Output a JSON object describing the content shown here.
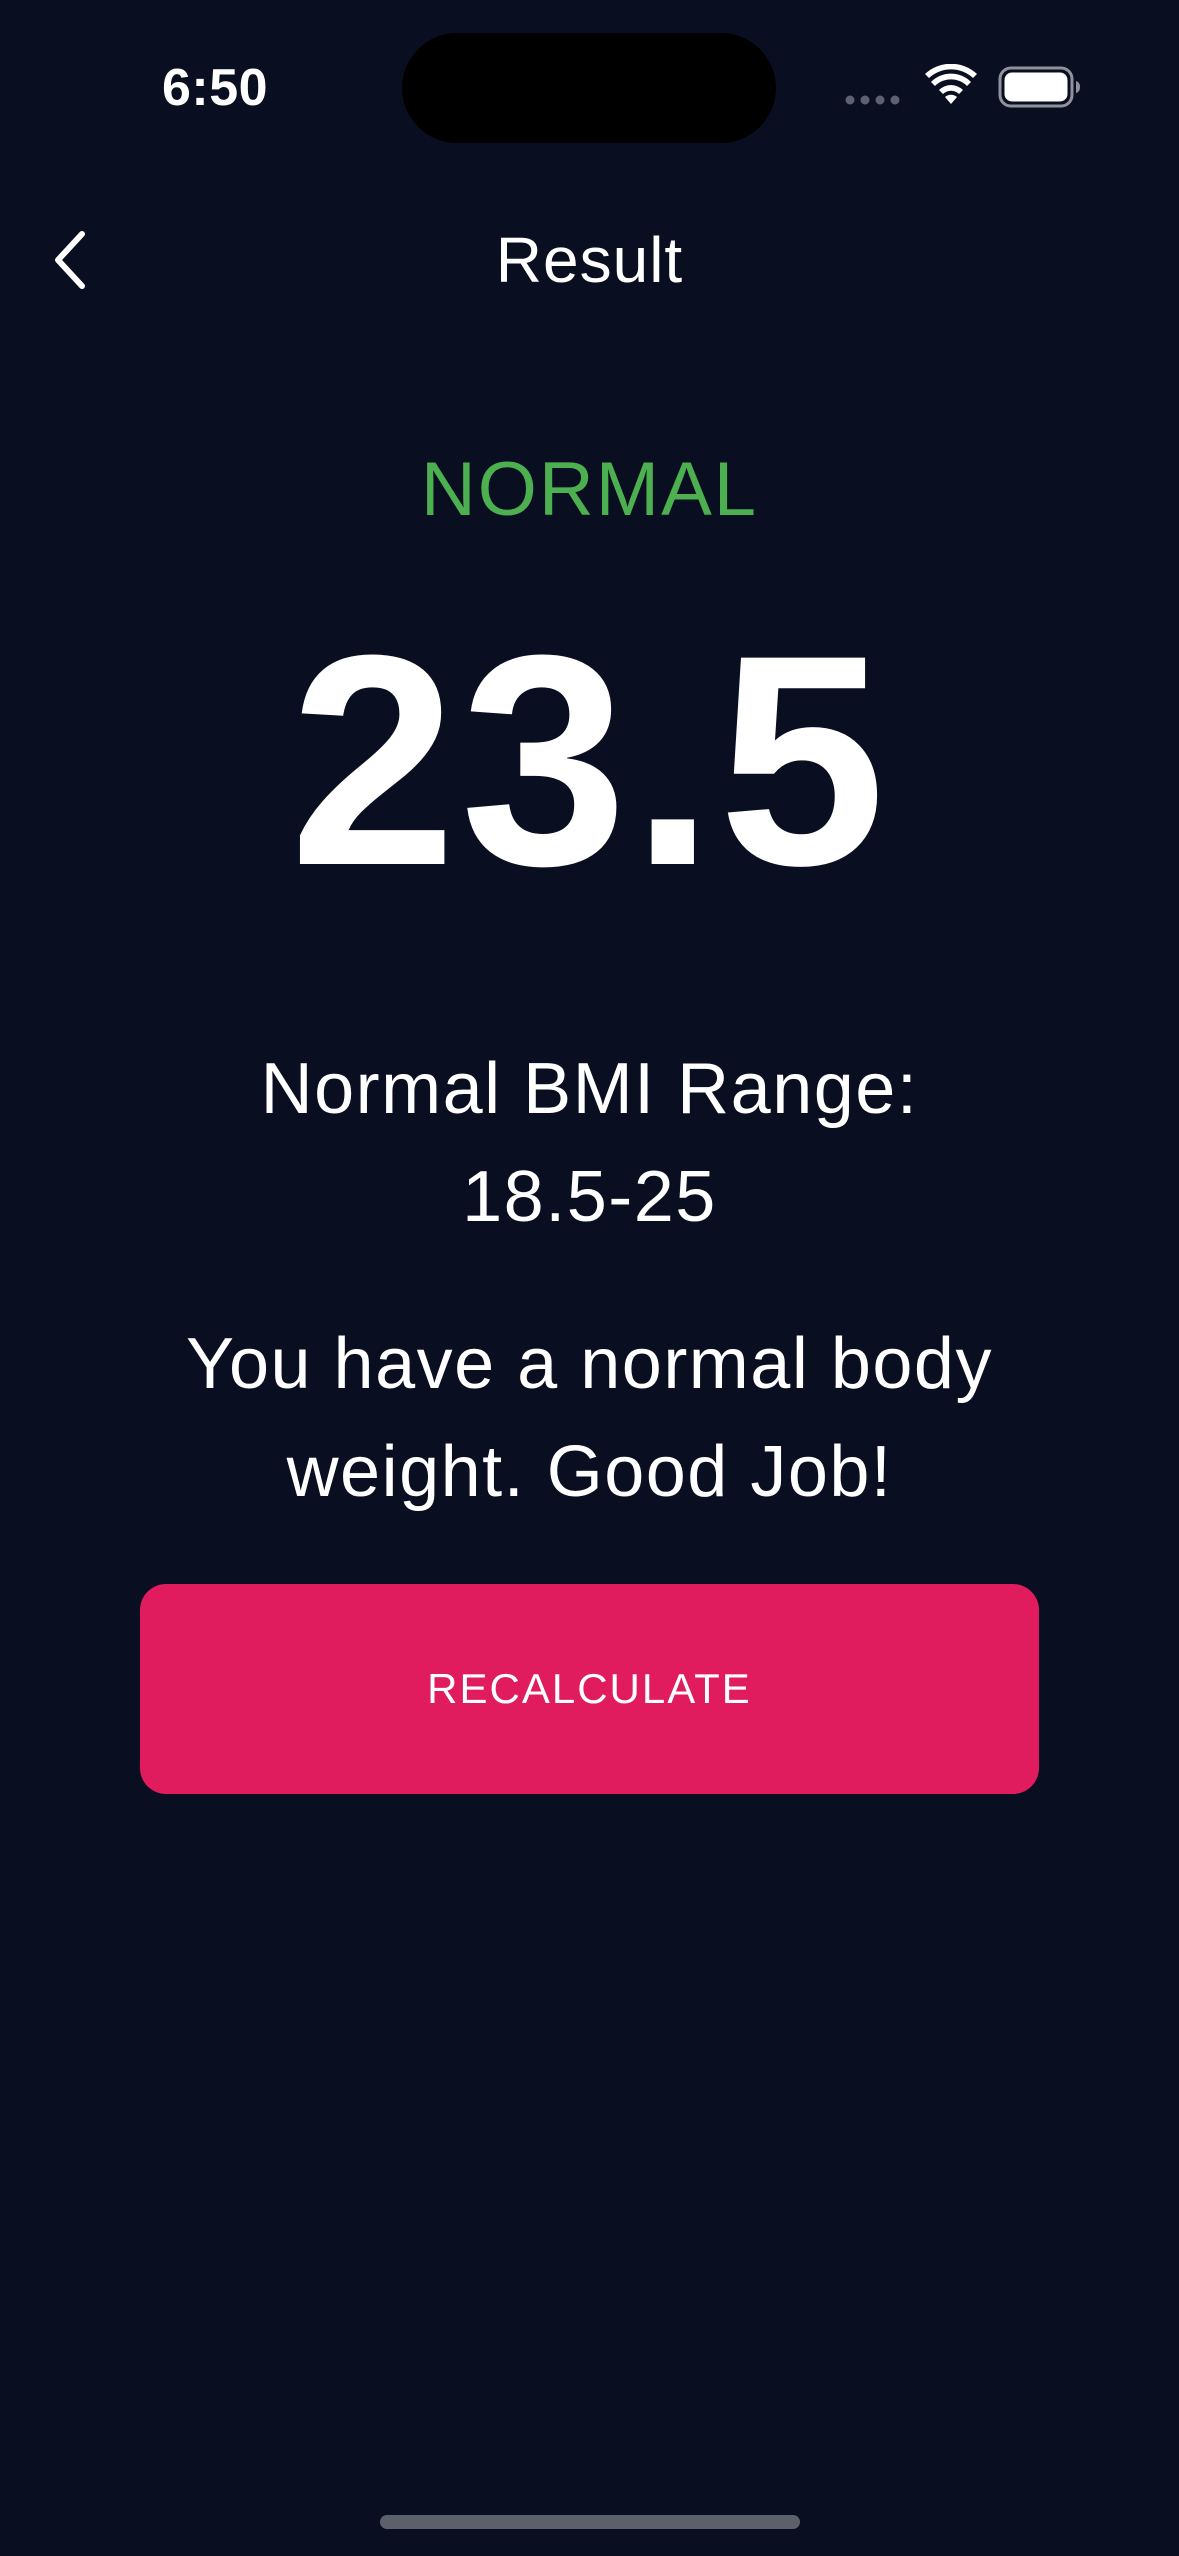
{
  "status_bar": {
    "time": "6:50",
    "signal_icon": "cellular-dots-icon",
    "wifi_icon": "wifi-icon",
    "battery_icon": "battery-icon"
  },
  "nav": {
    "back_icon": "chevron-left-icon",
    "title": "Result"
  },
  "result": {
    "category": "NORMAL",
    "bmi": "23.5",
    "range_label": "Normal BMI Range:",
    "range_value": "18.5-25",
    "message": "You have a normal body weight. Good Job!"
  },
  "actions": {
    "recalculate_label": "RECALCULATE"
  },
  "colors": {
    "background": "#0A0E21",
    "category_green": "#4CAF50",
    "accent_pink": "#E01B5E",
    "text": "#FFFFFF"
  }
}
